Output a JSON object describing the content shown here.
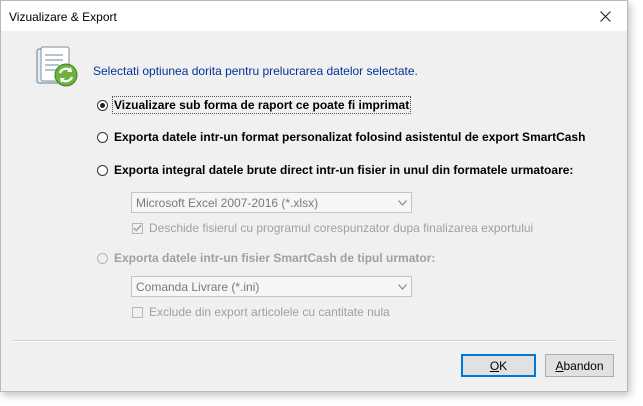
{
  "window": {
    "title": "Vizualizare & Export"
  },
  "header": {
    "text": "Selectati optiunea dorita pentru prelucrarea datelor selectate."
  },
  "options": {
    "report": {
      "label": "Vizualizare sub forma de raport ce poate fi imprimat",
      "checked": true,
      "enabled": true
    },
    "custom_export": {
      "label": "Exporta datele intr-un format personalizat folosind asistentul de export SmartCash",
      "checked": false,
      "enabled": true
    },
    "raw_export": {
      "label": "Exporta integral datele brute direct intr-un fisier in unul din formatele urmatoare:",
      "checked": false,
      "enabled": true
    },
    "smartcash_export": {
      "label": "Exporta datele intr-un fisier SmartCash de tipul urmator:",
      "checked": false,
      "enabled": false
    }
  },
  "raw_export": {
    "format_value": "Microsoft Excel 2007-2016 (*.xlsx)",
    "open_file_label": "Deschide fisierul cu programul corespunzator dupa finalizarea exportului",
    "open_file_checked": true
  },
  "smartcash_export": {
    "type_value": "Comanda Livrare (*.ini)",
    "exclude_zero_label": "Exclude din export articolele cu cantitate nula",
    "exclude_zero_checked": false
  },
  "buttons": {
    "ok": "OK",
    "cancel": "Abandon"
  },
  "colors": {
    "header_text": "#003399",
    "accent": "#0078d7",
    "disabled_text": "#a0a0a0"
  }
}
